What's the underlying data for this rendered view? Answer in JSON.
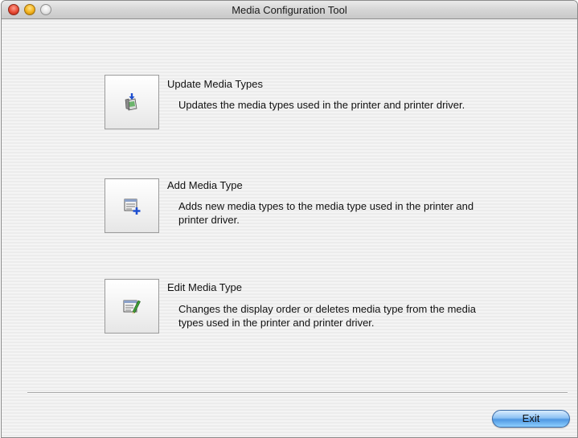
{
  "window": {
    "title": "Media Configuration Tool"
  },
  "options": [
    {
      "title": "Update Media Types",
      "description": "Updates the media types used in the printer and printer driver.",
      "icon": "update-media-icon"
    },
    {
      "title": "Add Media Type",
      "description": "Adds new media types to the media type used in the printer and printer driver.",
      "icon": "add-media-icon"
    },
    {
      "title": "Edit Media Type",
      "description": "Changes the display order or deletes media type from the media types used in the printer and printer driver.",
      "icon": "edit-media-icon"
    }
  ],
  "footer": {
    "exit_label": "Exit"
  },
  "colors": {
    "exit_button": "#6aaeee",
    "close_button": "#e64a34",
    "minimize_button": "#f3b21b"
  }
}
